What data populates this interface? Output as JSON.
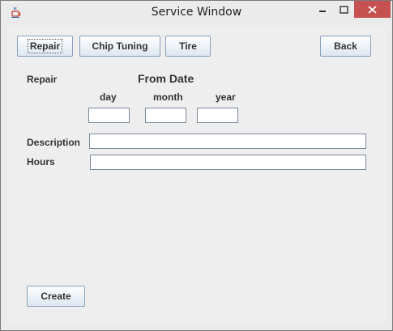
{
  "window": {
    "title": "Service Window",
    "close_color": "#c75050"
  },
  "toolbar": {
    "repair_label": "Repair",
    "chip_tuning_label": "Chip Tuning",
    "tire_label": "Tire",
    "back_label": "Back"
  },
  "form": {
    "section_label": "Repair",
    "from_date_heading": "From Date",
    "day_label": "day",
    "month_label": "month",
    "year_label": "year",
    "day_value": "",
    "month_value": "",
    "year_value": "",
    "description_label": "Description",
    "description_value": "",
    "hours_label": "Hours",
    "hours_value": "",
    "create_label": "Create"
  },
  "icons": {
    "app": "java-cup-icon",
    "minimize": "minimize-icon",
    "maximize": "maximize-icon",
    "close": "close-icon"
  }
}
